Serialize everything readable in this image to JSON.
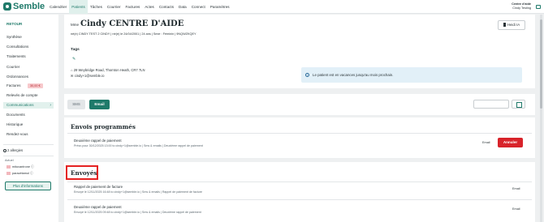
{
  "app": {
    "logo": "Semble"
  },
  "nav": {
    "items": [
      "Calendrier",
      "Patients",
      "Tâches",
      "Courrier",
      "Factures",
      "Actes",
      "Contacts",
      "Data",
      "Connect",
      "Paramètres"
    ],
    "active": "Patients"
  },
  "user": {
    "org": "Centre d'aide",
    "name": "Cindy Testing"
  },
  "sidebar": {
    "back": "RETOUR",
    "items": [
      "Synthèse",
      "Consultations",
      "Traitements",
      "Courrier",
      "Ordonnances",
      "Factures",
      "Relevés de compte",
      "Communications",
      "Documents",
      "Historique",
      "Rendez-vous"
    ],
    "active": "Communications",
    "invoice_badge": "30,00 €",
    "allergies_title": "2 allergies",
    "allergies_current_label": "Actuel",
    "allergens": [
      "mitoxantrone ⓘ",
      "paracétamol ⓘ"
    ],
    "more_info_button": "Plus d'informations"
  },
  "patient": {
    "prefix": "Mme",
    "name": "Cindy CENTRE D'AIDE",
    "meta": "né(e) CINDY TEST 2 CINDY  |  né(e) le 24/04/2001  |  24 ans  |  Sexe : Féminin  |  9NQWZKQEY",
    "heidi_button": "Heidi IA"
  },
  "tags": {
    "title": "Tags",
    "address": "29 Weybridge Road, Thornton Heath, CR7 7LN",
    "email": "cindy+1@semble.io",
    "vacation_alert": "Le patient est en vacances jusqu'au mois prochain."
  },
  "compose": {
    "sms": "SMS",
    "email": "Email",
    "filter_value": ""
  },
  "scheduled": {
    "title": "Envois programmés",
    "items": [
      {
        "title": "Deuxième rappel de paiement",
        "meta": "Prévu pour 30/12/2025 13:00 to cindy+1@semble.io  |  Sms & emails  |  Deuxième rappel de paiement",
        "channel": "Email",
        "cancel": "Annuler"
      }
    ]
  },
  "sent": {
    "title": "Envoyés",
    "items": [
      {
        "title": "Rappel de paiement de facture",
        "meta": "Envoyé le 12/11/2025 16:48 to cindy+1@semble.io  |  Sms & emails  |  Rappel de paiement de facture",
        "channel": "Email"
      },
      {
        "title": "Deuxième rappel de paiement",
        "meta": "Envoyé le 12/11/2025 09:48 to cindy+1@semble.io  |  Sms & emails  |  Deuxième rappel de paiement",
        "channel": "Email"
      }
    ]
  },
  "colors": {
    "brand": "#1f7a6a",
    "danger": "#d8232a",
    "highlight": "#e52222",
    "alert_bg": "#e2f0f8"
  }
}
